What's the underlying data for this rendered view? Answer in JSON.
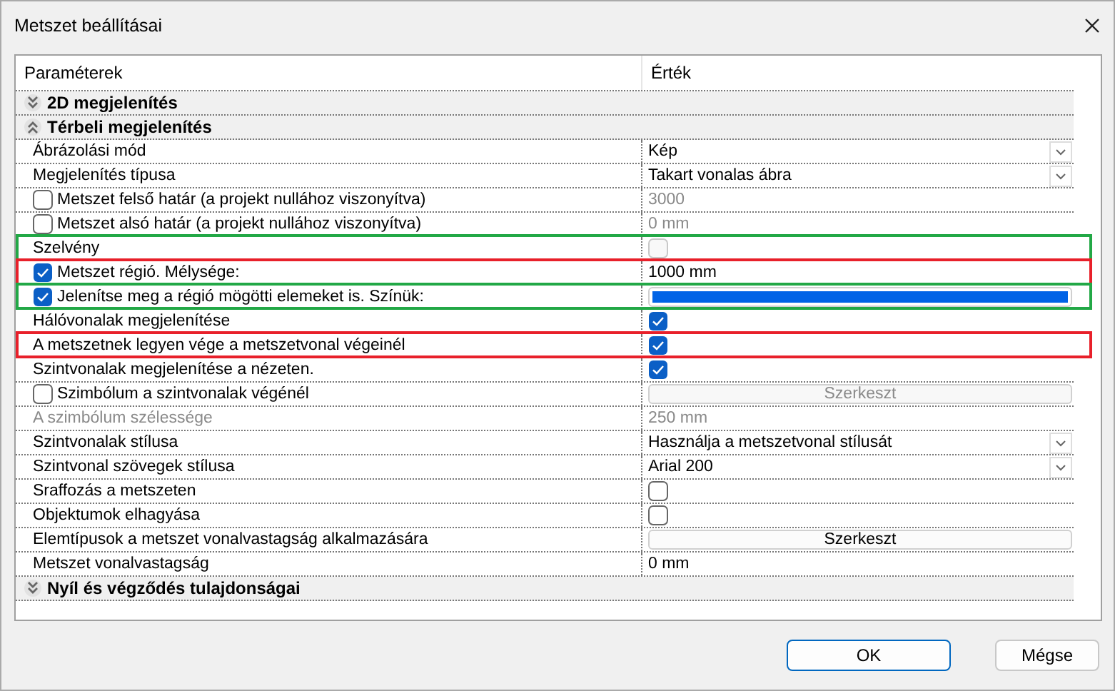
{
  "window": {
    "title": "Metszet beállításai"
  },
  "grid": {
    "columns": [
      "Paraméterek",
      "Érték"
    ],
    "rows": [
      {
        "kind": "section",
        "label": "2D megjelenítés",
        "expanded": false
      },
      {
        "kind": "section",
        "label": "Térbeli megjelenítés",
        "expanded": true
      },
      {
        "kind": "property",
        "label": "Ábrázolási mód",
        "disabled": false,
        "value": {
          "kind": "dropdown",
          "text": "Kép"
        }
      },
      {
        "kind": "property",
        "label": "Megjelenítés típusa",
        "disabled": false,
        "value": {
          "kind": "dropdown",
          "text": "Takart vonalas ábra"
        }
      },
      {
        "kind": "property",
        "label": "Metszet felső határ (a projekt nullához viszonyítva)",
        "checked": false,
        "disabled": false,
        "value": {
          "kind": "text",
          "text": "3000",
          "disabled": true
        }
      },
      {
        "kind": "property",
        "label": "Metszet alsó határ (a projekt nullához viszonyítva)",
        "checked": false,
        "disabled": false,
        "value": {
          "kind": "text",
          "text": "0 mm",
          "disabled": true
        }
      },
      {
        "kind": "property",
        "label": "Szelvény",
        "disabled": false,
        "color": "#22a846",
        "value": {
          "kind": "checkbox",
          "checked": false,
          "disabled": true
        }
      },
      {
        "kind": "property",
        "label": "Metszet régió. Mélysége:",
        "checked": true,
        "disabled": false,
        "color": "#e8202a",
        "value": {
          "kind": "text",
          "text": "1000 mm",
          "disabled": false
        }
      },
      {
        "kind": "property",
        "label": "Jelenítse meg a régió mögötti elemeket is. Színük:",
        "checked": true,
        "disabled": false,
        "color": "#22a846",
        "value": {
          "kind": "swatch",
          "color": "#0063e6"
        }
      },
      {
        "kind": "property",
        "label": "Hálóvonalak megjelenítése",
        "disabled": false,
        "value": {
          "kind": "checkbox",
          "checked": true
        }
      },
      {
        "kind": "property",
        "label": "A metszetnek legyen vége a metszetvonal végeinél",
        "disabled": false,
        "color": "#e8202a",
        "value": {
          "kind": "checkbox",
          "checked": true
        }
      },
      {
        "kind": "property",
        "label": "Szintvonalak megjelenítése a nézeten.",
        "disabled": false,
        "value": {
          "kind": "checkbox",
          "checked": true
        }
      },
      {
        "kind": "property",
        "label": "Szimbólum a szintvonalak végénél",
        "checked": false,
        "disabled": false,
        "value": {
          "kind": "button",
          "text": "Szerkeszt",
          "disabled": true
        }
      },
      {
        "kind": "property",
        "label": "A szimbólum szélessége",
        "disabled": true,
        "value": {
          "kind": "text",
          "text": "250 mm",
          "disabled": true
        }
      },
      {
        "kind": "property",
        "label": "Szintvonalak stílusa",
        "disabled": false,
        "value": {
          "kind": "dropdown",
          "text": "Használja a metszetvonal stílusát"
        }
      },
      {
        "kind": "property",
        "label": "Szintvonal szövegek stílusa",
        "disabled": false,
        "value": {
          "kind": "dropdown",
          "text": "Arial 200"
        }
      },
      {
        "kind": "property",
        "label": "Sraffozás a metszeten",
        "disabled": false,
        "value": {
          "kind": "checkbox",
          "checked": false,
          "disabled": false
        }
      },
      {
        "kind": "property",
        "label": "Objektumok elhagyása",
        "disabled": false,
        "value": {
          "kind": "checkbox",
          "checked": false,
          "disabled": false
        }
      },
      {
        "kind": "property",
        "label": "Elemtípusok a metszet vonalvastagság alkalmazására",
        "disabled": false,
        "value": {
          "kind": "button",
          "text": "Szerkeszt",
          "disabled": false
        }
      },
      {
        "kind": "property",
        "label": "Metszet vonalvastagság",
        "disabled": false,
        "value": {
          "kind": "text",
          "text": "0 mm",
          "disabled": false
        }
      },
      {
        "kind": "section",
        "label": "Nyíl és végződés tulajdonságai",
        "expanded": false
      }
    ]
  },
  "buttons": [
    {
      "label": "OK",
      "default": true
    },
    {
      "label": "Mégse",
      "default": false
    }
  ]
}
